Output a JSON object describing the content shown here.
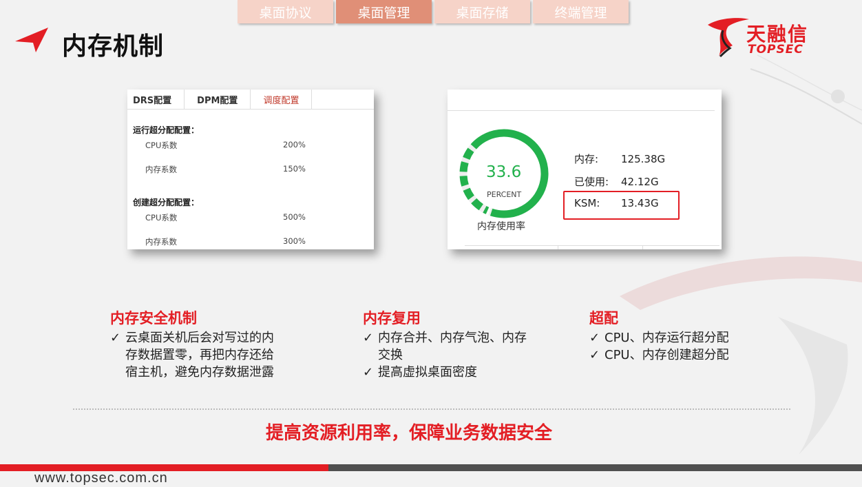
{
  "nav": {
    "tabs": [
      {
        "label": "桌面协议",
        "active": false
      },
      {
        "label": "桌面管理",
        "active": true
      },
      {
        "label": "桌面存储",
        "active": false
      },
      {
        "label": "终端管理",
        "active": false
      }
    ]
  },
  "page": {
    "title": "内存机制"
  },
  "logo": {
    "name_cn": "天融信",
    "name_en": "TOPSEC"
  },
  "config_panel": {
    "tabs": [
      "DRS配置",
      "DPM配置",
      "调度配置"
    ],
    "active_tab": "调度配置",
    "sections": [
      {
        "title": "运行超分配配置：",
        "rows": [
          {
            "label": "CPU系数",
            "value": "200%"
          },
          {
            "label": "内存系数",
            "value": "150%"
          }
        ]
      },
      {
        "title": "创建超分配配置：",
        "rows": [
          {
            "label": "CPU系数",
            "value": "500%"
          },
          {
            "label": "内存系数",
            "value": "300%"
          }
        ]
      }
    ]
  },
  "memory_panel": {
    "gauge_value": "33.6",
    "gauge_percent": 33.6,
    "gauge_unit": "PERCENT",
    "gauge_label": "内存使用率",
    "gauge_color": "#22b14c",
    "stats": [
      {
        "key": "内存:",
        "value": "125.38G"
      },
      {
        "key": "已使用:",
        "value": "42.12G"
      },
      {
        "key": "KSM:",
        "value": "13.43G",
        "highlighted": true
      }
    ]
  },
  "features": [
    {
      "title": "内存安全机制",
      "items": [
        {
          "lines": [
            "云桌面关机后会对写过的内",
            "存数据置零，再把内存还给",
            "宿主机，避免内存数据泄露"
          ]
        }
      ]
    },
    {
      "title": "内存复用",
      "items": [
        {
          "lines": [
            "内存合并、内存气泡、内存",
            "交换"
          ]
        },
        {
          "lines": [
            "提高虚拟桌面密度"
          ]
        }
      ]
    },
    {
      "title": "超配",
      "items": [
        {
          "lines": [
            "CPU、内存运行超分配"
          ]
        },
        {
          "lines": [
            "CPU、内存创建超分配"
          ]
        }
      ]
    }
  ],
  "check_mark": "✓",
  "slogan": "提高资源利用率，保障业务数据安全",
  "footer": {
    "url": "www.topsec.com.cn"
  },
  "colors": {
    "accent": "#e31e24",
    "tab_active": "#e08f77",
    "tab_inactive": "#f6d3c8"
  }
}
